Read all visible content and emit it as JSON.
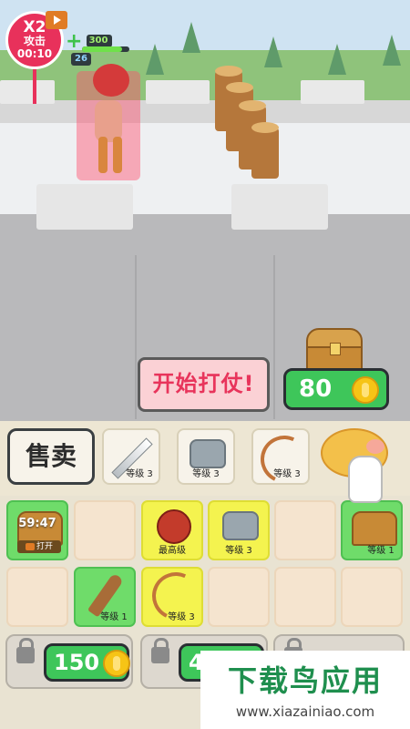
{
  "hud": {
    "multiplier": "X2",
    "mode": "攻击",
    "timer": "00:10",
    "hp_value": "300",
    "hp_fraction": 0.85,
    "level": "26"
  },
  "battle": {
    "start_label": "开始打仗!",
    "chest_price": "80"
  },
  "shop": {
    "sell_label": "售卖",
    "items": [
      {
        "icon": "sword-icon",
        "level": "等级 3"
      },
      {
        "icon": "armor-icon",
        "level": "等级 3"
      },
      {
        "icon": "bow-icon",
        "level": "等级 3"
      }
    ]
  },
  "inventory": {
    "row1": [
      {
        "icon": "treasure-chest-icon",
        "color": "green",
        "timer": "59:47",
        "action": "打开"
      },
      {
        "icon": "",
        "color": "empty"
      },
      {
        "icon": "health-potion-icon",
        "color": "yellow",
        "level": "最高级"
      },
      {
        "icon": "armor-icon",
        "color": "yellow",
        "level": "等级 3"
      },
      {
        "icon": "",
        "color": "empty"
      },
      {
        "icon": "treasure-chest-icon",
        "color": "green",
        "level": "等级 1"
      }
    ],
    "row2": [
      {
        "icon": "",
        "color": "empty"
      },
      {
        "icon": "club-icon",
        "color": "green",
        "level": "等级 1"
      },
      {
        "icon": "bow-icon",
        "color": "yellow",
        "level": "等级 3"
      },
      {
        "icon": "",
        "color": "empty"
      },
      {
        "icon": "",
        "color": "empty"
      },
      {
        "icon": "",
        "color": "empty"
      }
    ]
  },
  "unlock": {
    "slot1_price": "150",
    "slot2_price": "4"
  },
  "watermark": {
    "title": "下载鸟应用",
    "url": "www.xiazainiao.com"
  },
  "colors": {
    "accent_red": "#e8315b",
    "button_green": "#3ec65a",
    "slot_green": "#6fdc6a",
    "slot_yellow": "#f4f34f"
  }
}
